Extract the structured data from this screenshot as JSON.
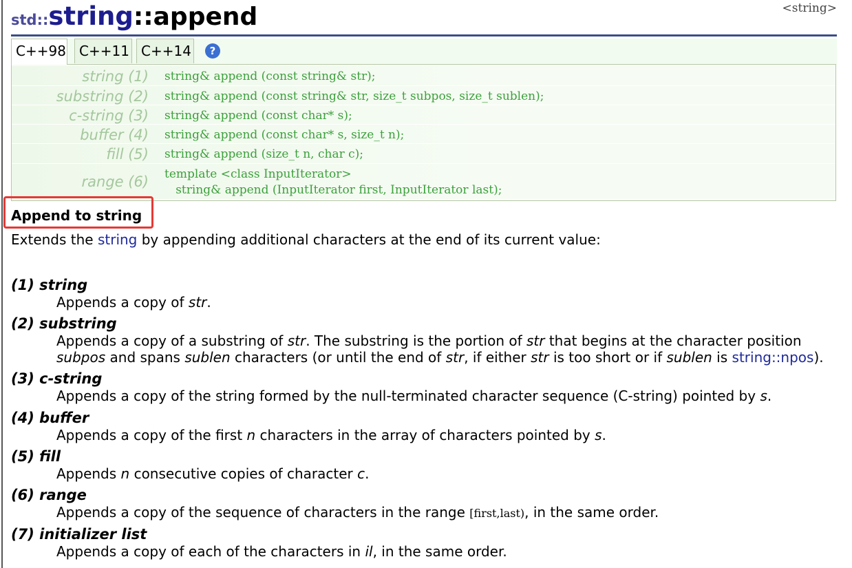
{
  "header": {
    "namespace": "std::",
    "class": "string",
    "sep": "::",
    "function": "append",
    "header_link": "<string>"
  },
  "tabs": [
    {
      "label": "C++98",
      "active": true
    },
    {
      "label": "C++11",
      "active": false
    },
    {
      "label": "C++14",
      "active": false
    }
  ],
  "help_label": "?",
  "signatures": [
    {
      "label": "string (1)",
      "code": "string& append (const string& str);"
    },
    {
      "label": "substring (2)",
      "code": "string& append (const string& str, size_t subpos, size_t sublen);"
    },
    {
      "label": "c-string (3)",
      "code": "string& append (const char* s);"
    },
    {
      "label": "buffer (4)",
      "code": "string& append (const char* s, size_t n);"
    },
    {
      "label": "fill (5)",
      "code": "string& append (size_t n, char c);"
    },
    {
      "label": "range (6)",
      "code": "template <class InputIterator>\n   string& append (InputIterator first, InputIterator last);"
    }
  ],
  "section_title": "Append to string",
  "intro": {
    "pre": "Extends the ",
    "link": "string",
    "post": " by appending additional characters at the end of its current value:"
  },
  "items": [
    {
      "head": "(1) string",
      "desc": [
        "Appends a copy of ",
        "str",
        "."
      ]
    },
    {
      "head": "(2) substring",
      "line1": [
        "Appends a copy of a substring of ",
        "str",
        ". The substring is the portion of ",
        "str",
        " that begins at the character position"
      ],
      "line2": [
        "subpos",
        " and spans ",
        "sublen",
        " characters (or until the end of ",
        "str",
        ", if either ",
        "str",
        " is too short or if ",
        "sublen",
        " is ",
        "string::npos",
        ")."
      ]
    },
    {
      "head": "(3) c-string",
      "desc": [
        "Appends a copy of the string formed by the null-terminated character sequence (C-string) pointed by ",
        "s",
        "."
      ]
    },
    {
      "head": "(4) buffer",
      "desc": [
        "Appends a copy of the first ",
        "n",
        " characters in the array of characters pointed by ",
        "s",
        "."
      ]
    },
    {
      "head": "(5) fill",
      "desc": [
        "Appends ",
        "n",
        " consecutive copies of character ",
        "c",
        "."
      ]
    },
    {
      "head": "(6) range",
      "desc": [
        "Appends a copy of the sequence of characters in the range ",
        "[first,last)",
        ", in the same order."
      ]
    },
    {
      "head": "(7) initializer list",
      "desc": [
        "Appends a copy of each of the characters in ",
        "il",
        ", in the same order."
      ]
    }
  ]
}
